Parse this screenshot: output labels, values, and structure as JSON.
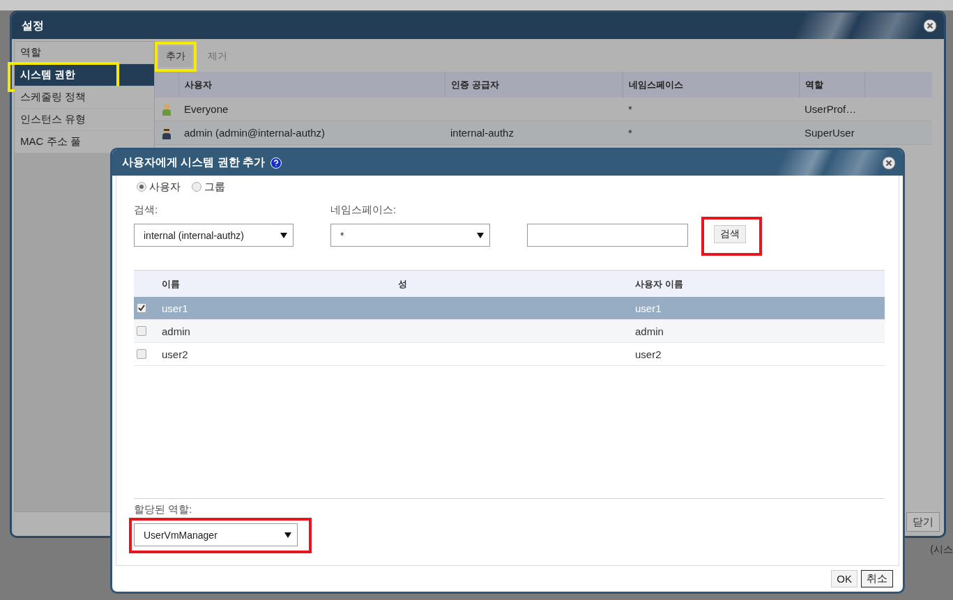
{
  "background": {
    "status_text": "(시스"
  },
  "settings": {
    "title": "설정",
    "sidebar": [
      {
        "label": "역할",
        "selected": false
      },
      {
        "label": "시스템 권한",
        "selected": true,
        "highlighted": true
      },
      {
        "label": "스케줄링 정책",
        "selected": false
      },
      {
        "label": "인스턴스 유형",
        "selected": false
      },
      {
        "label": "MAC 주소 풀",
        "selected": false
      }
    ],
    "toolbar": [
      {
        "label": "추가",
        "disabled": false,
        "highlighted": true
      },
      {
        "label": "제거",
        "disabled": true
      }
    ],
    "columns": [
      "사용자",
      "인증 공급자",
      "네임스페이스",
      "역할"
    ],
    "rows": [
      {
        "kind": "group",
        "user": "Everyone",
        "namespace": "*",
        "role": "UserProf…"
      },
      {
        "kind": "admin",
        "user": "admin (admin@internal-authz)",
        "provider": "internal-authz",
        "namespace": "*",
        "role": "SuperUser"
      }
    ],
    "close_button": "닫기"
  },
  "dialog": {
    "title": "사용자에게 시스템 권한 추가",
    "radios": [
      {
        "label": "사용자",
        "selected": true
      },
      {
        "label": "그룹",
        "selected": false
      }
    ],
    "search_label": "검색:",
    "search_select": "internal (internal-authz)",
    "namespace_label": "네임스페이스:",
    "namespace_select": "*",
    "search_button": {
      "label": "검색",
      "highlighted": true
    },
    "columns": [
      "이름",
      "성",
      "사용자 이름"
    ],
    "rows": [
      {
        "name": "user1",
        "username": "user1",
        "checked": true,
        "selected": true
      },
      {
        "name": "admin",
        "username": "admin",
        "checked": false,
        "selected": false
      },
      {
        "name": "user2",
        "username": "user2",
        "checked": false,
        "selected": false
      }
    ],
    "role_label": "할당된 역할:",
    "role_select": {
      "value": "UserVmManager",
      "highlighted": true
    },
    "buttons": [
      {
        "label": "OK",
        "default": false
      },
      {
        "label": "취소",
        "default": true
      }
    ]
  }
}
